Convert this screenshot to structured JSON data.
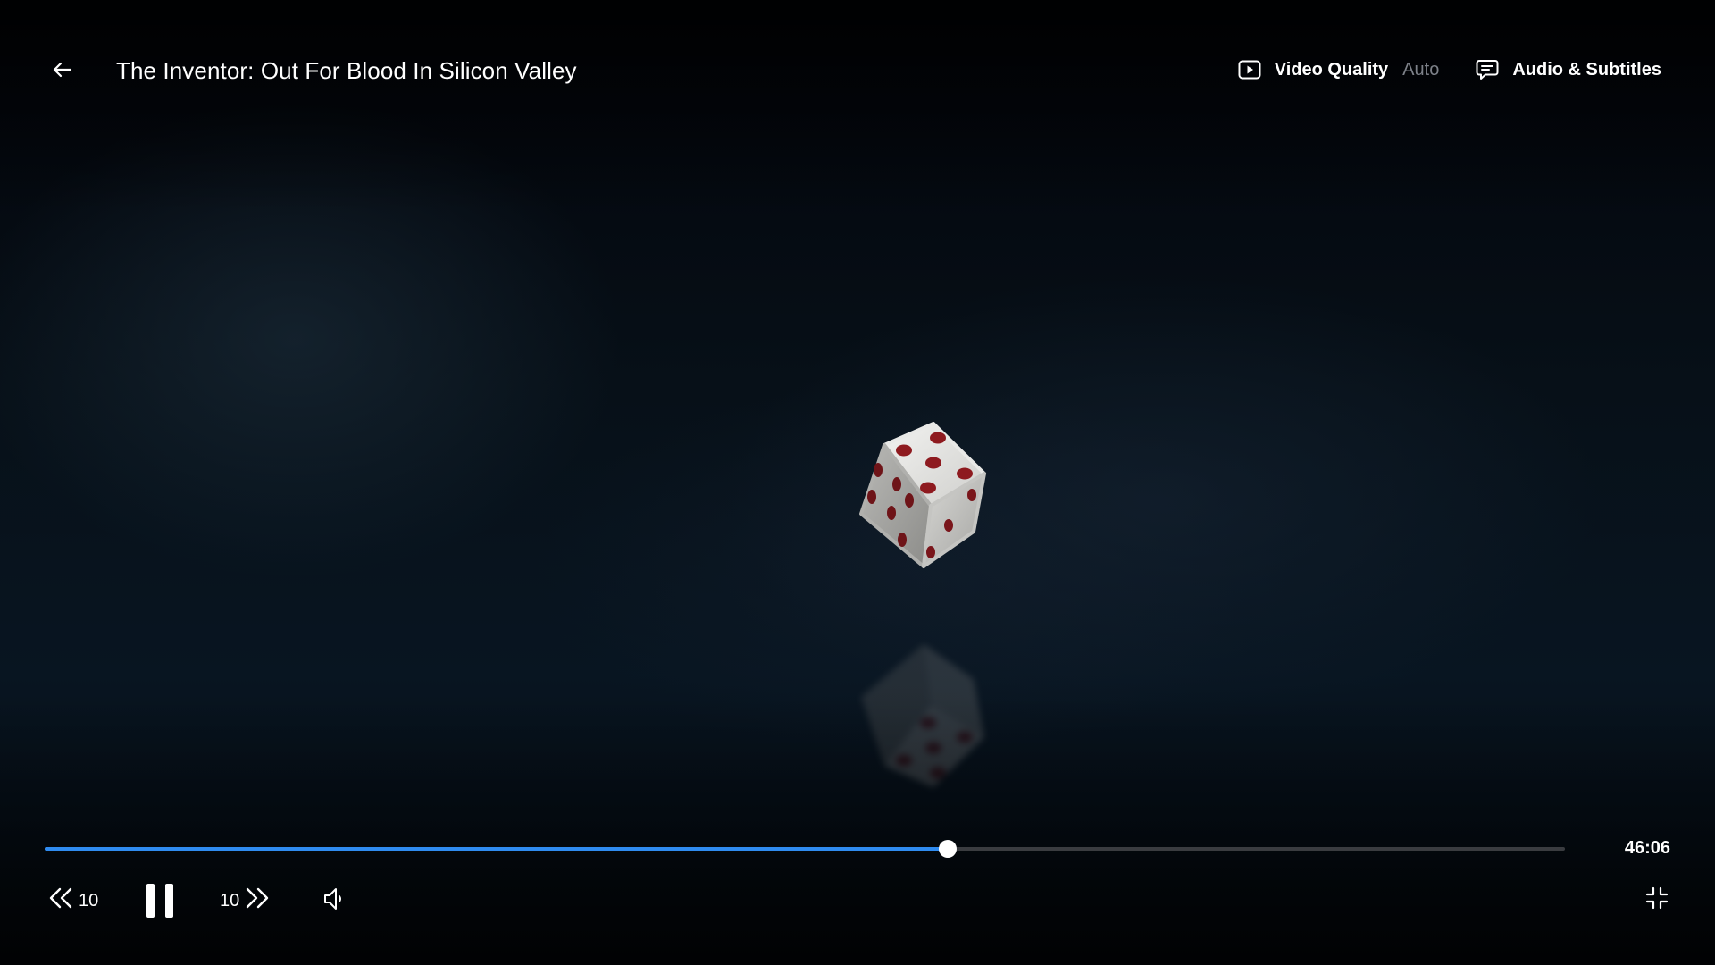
{
  "header": {
    "back_icon": "arrow-left-icon",
    "title": "The Inventor: Out For Blood In Silicon Valley",
    "video_quality": {
      "icon": "play-square-icon",
      "label": "Video Quality",
      "value": "Auto"
    },
    "audio_subtitles": {
      "icon": "chat-bubble-icon",
      "label": "Audio & Subtitles"
    }
  },
  "progress": {
    "played_fraction": 0.594,
    "remaining_time": "46:06",
    "colors": {
      "played": "#2f8bf0",
      "track": "#3a3c40",
      "thumb": "#ffffff"
    }
  },
  "controls": {
    "rewind": {
      "icon": "double-chevron-left-icon",
      "seconds_label": "10"
    },
    "pause": {
      "icon": "pause-icon"
    },
    "forward": {
      "icon": "double-chevron-right-icon",
      "seconds_label": "10"
    },
    "volume": {
      "icon": "speaker-icon"
    },
    "exit_fullscreen": {
      "icon": "exit-fullscreen-icon"
    }
  }
}
